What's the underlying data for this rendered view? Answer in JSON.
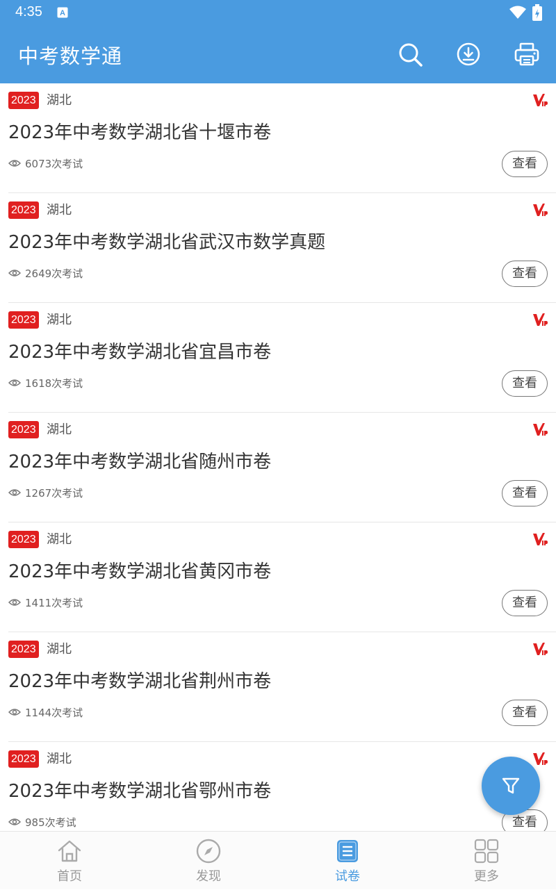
{
  "status_bar": {
    "time": "4:35"
  },
  "app_bar": {
    "title": "中考数学通",
    "icons": [
      "search-icon",
      "download-icon",
      "print-icon"
    ]
  },
  "papers": [
    {
      "year": "2023",
      "province": "湖北",
      "title": "2023年中考数学湖北省十堰市卷",
      "views": "6073次考试",
      "button": "查看"
    },
    {
      "year": "2023",
      "province": "湖北",
      "title": "2023年中考数学湖北省武汉市数学真题",
      "views": "2649次考试",
      "button": "查看"
    },
    {
      "year": "2023",
      "province": "湖北",
      "title": "2023年中考数学湖北省宜昌市卷",
      "views": "1618次考试",
      "button": "查看"
    },
    {
      "year": "2023",
      "province": "湖北",
      "title": "2023年中考数学湖北省随州市卷",
      "views": "1267次考试",
      "button": "查看"
    },
    {
      "year": "2023",
      "province": "湖北",
      "title": "2023年中考数学湖北省黄冈市卷",
      "views": "1411次考试",
      "button": "查看"
    },
    {
      "year": "2023",
      "province": "湖北",
      "title": "2023年中考数学湖北省荆州市卷",
      "views": "1144次考试",
      "button": "查看"
    },
    {
      "year": "2023",
      "province": "湖北",
      "title": "2023年中考数学湖北省鄂州市卷",
      "views": "985次考试",
      "button": "查看"
    }
  ],
  "bottom_nav": [
    {
      "label": "首页",
      "icon": "home-icon",
      "active": false
    },
    {
      "label": "发现",
      "icon": "compass-icon",
      "active": false
    },
    {
      "label": "试卷",
      "icon": "paper-list-icon",
      "active": true
    },
    {
      "label": "更多",
      "icon": "grid-icon",
      "active": false
    }
  ],
  "colors": {
    "primary": "#4a9be0",
    "year_badge": "#e02020",
    "vip": "#e02020"
  }
}
